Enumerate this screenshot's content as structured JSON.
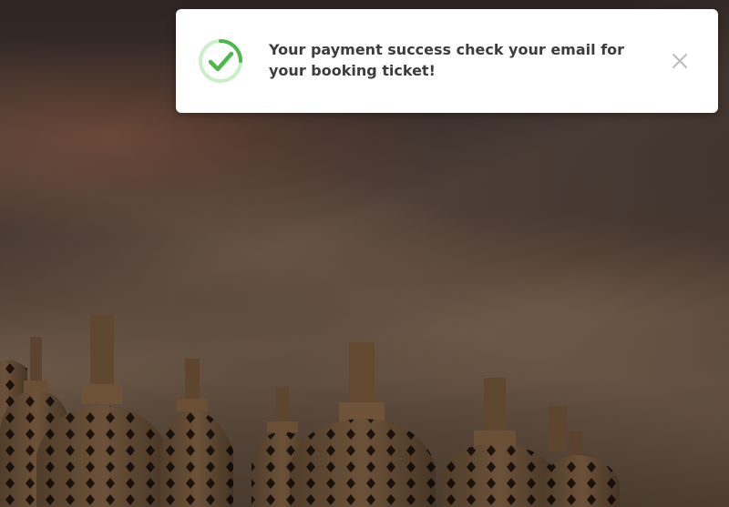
{
  "toast": {
    "status": "success",
    "message": "Your payment success check your email for your booking ticket!",
    "icon": "check-circle-icon",
    "close_icon": "close-icon",
    "accent_color": "#4cb84a",
    "ring_color": "#c9efc6"
  },
  "background": {
    "scene": "stupa-silhouettes-at-dusk"
  }
}
